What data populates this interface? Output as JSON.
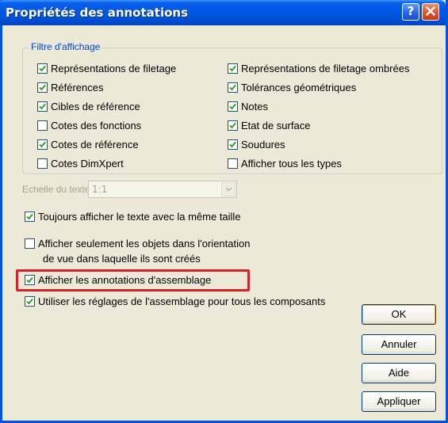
{
  "dialog": {
    "title": "Propriétés des annotations",
    "help_button": "?"
  },
  "display_filter": {
    "legend": "Filtre d'affichage",
    "left_column": [
      {
        "label": "Représentations de filetage",
        "checked": true
      },
      {
        "label": "Références",
        "checked": true
      },
      {
        "label": "Cibles de référence",
        "checked": true
      },
      {
        "label": "Cotes des fonctions",
        "checked": false
      },
      {
        "label": "Cotes de référence",
        "checked": true
      },
      {
        "label": "Cotes DimXpert",
        "checked": false
      }
    ],
    "right_column": [
      {
        "label": "Représentations de filetage ombrées",
        "checked": true
      },
      {
        "label": "Tolérances géométriques",
        "checked": true
      },
      {
        "label": "Notes",
        "checked": true
      },
      {
        "label": "Etat de surface",
        "checked": true
      },
      {
        "label": "Soudures",
        "checked": true
      },
      {
        "label": "Afficher tous les types",
        "checked": false
      }
    ]
  },
  "text_scale": {
    "label": "Echelle du texte:",
    "value": "1:1",
    "disabled": true
  },
  "options": {
    "always_same_size": {
      "label": "Toujours afficher le texte avec la même taille",
      "checked": true
    },
    "only_in_orientation": {
      "label": "Afficher seulement les objets dans l'orientation",
      "label_line2": "de vue dans laquelle ils sont créés",
      "checked": false
    },
    "show_assembly_annotations": {
      "label": "Afficher les annotations d'assemblage",
      "checked": true
    },
    "use_assembly_settings": {
      "label": "Utiliser les réglages de l'assemblage pour tous les composants",
      "checked": true
    }
  },
  "buttons": {
    "ok": "OK",
    "cancel": "Annuler",
    "help": "Aide",
    "apply": "Appliquer"
  },
  "colors": {
    "title_bar": "#0054e3",
    "dialog_bg": "#ece9d8",
    "highlight": "#d2232a",
    "checkmark": "#21a121",
    "legend_text": "#0046d5"
  }
}
